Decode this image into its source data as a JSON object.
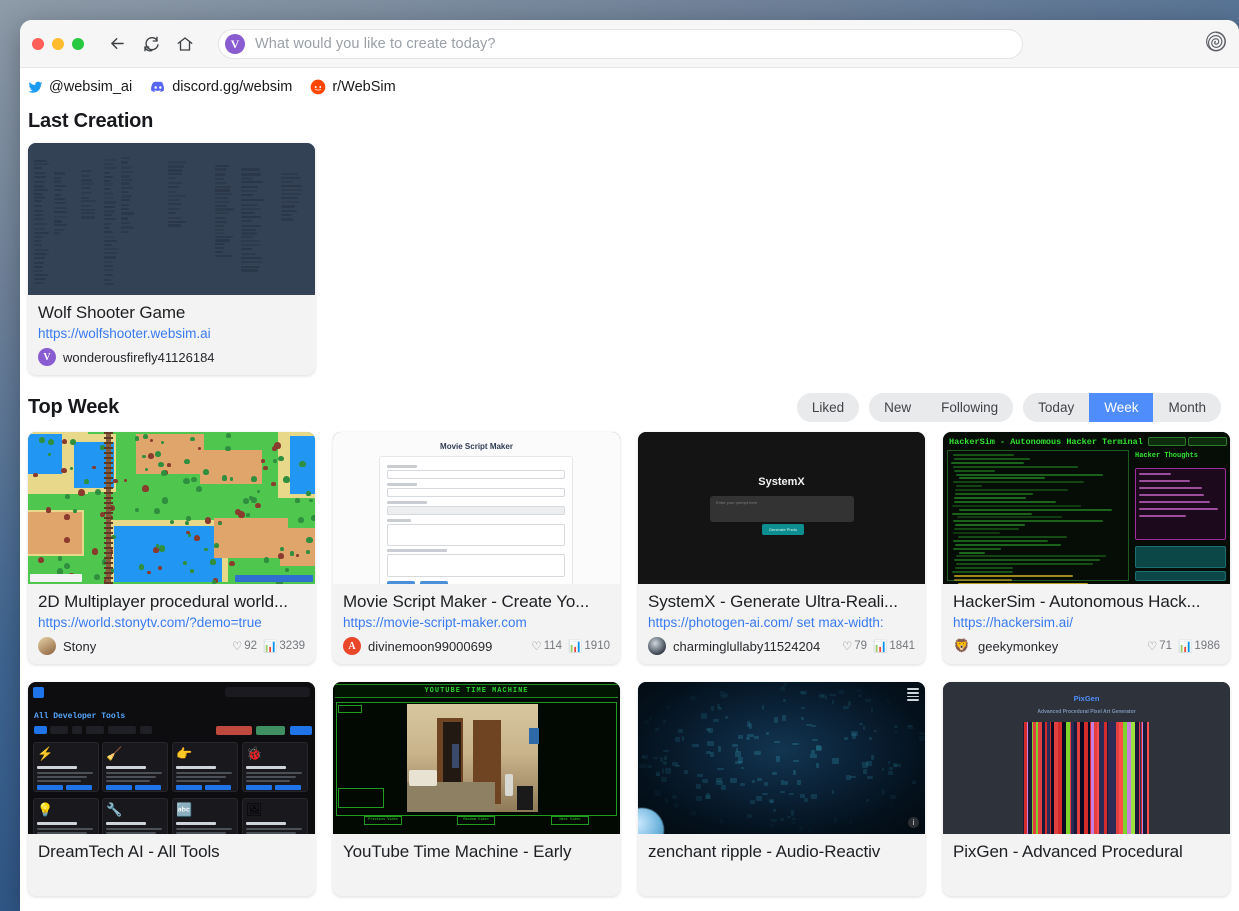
{
  "browser": {
    "back_label": "Back",
    "reload_label": "Reload",
    "home_label": "Home",
    "url_placeholder": "What would you like to create today?",
    "favicon_letter": "V",
    "spiral_label": "websim-logo"
  },
  "social": [
    {
      "icon": "twitter-icon",
      "label": "@websim_ai"
    },
    {
      "icon": "discord-icon",
      "label": "discord.gg/websim"
    },
    {
      "icon": "reddit-icon",
      "label": "r/WebSim"
    }
  ],
  "last_creation": {
    "heading": "Last Creation",
    "card": {
      "title": "Wolf Shooter Game",
      "url": "https://wolfshooter.websim.ai",
      "author": "wonderousfirefly41126184",
      "avatar_letter": "V",
      "avatar_color": "#8a5cd1"
    }
  },
  "top_week": {
    "heading": "Top Week",
    "filters_left": [
      "Liked"
    ],
    "filters_mid": [
      "New",
      "Following"
    ],
    "filters_right": [
      "Today",
      "Week",
      "Month"
    ],
    "active_filter": "Week",
    "accent_color": "#4f8dfd"
  },
  "cards": [
    {
      "title": "2D Multiplayer procedural world...",
      "url": "https://world.stonytv.com/?demo=true",
      "author": "Stony",
      "likes": "92",
      "views": "3239",
      "art": "world"
    },
    {
      "title": "Movie Script Maker - Create Yo...",
      "url": "https://movie-script-maker.com",
      "author": "divinemoon99000699",
      "avatar_letter": "A",
      "avatar_color": "#e8472a",
      "likes": "114",
      "views": "1910",
      "art": "msm",
      "art_title": "Movie Script Maker",
      "art_fields": [
        "Movie Name:",
        "Movie Genre:",
        "Number of Chapters:",
        "Synopsis:",
        "List of Characters (one per line):"
      ]
    },
    {
      "title": "SystemX - Generate Ultra-Reali...",
      "url": "https://photogen-ai.com/ set max-width:",
      "author": "charminglullaby11524204",
      "likes": "79",
      "views": "1841",
      "art": "sysx",
      "art_title": "SystemX",
      "art_placeholder": "Enter your prompt here",
      "art_button": "Generate Photo"
    },
    {
      "title": "HackerSim - Autonomous Hack...",
      "url": "https://hackersim.ai/",
      "author": "geekymonkey",
      "likes": "71",
      "views": "1986",
      "art": "hack",
      "art_title": "HackerSim - Autonomous Hacker Terminal",
      "art_panel": "Hacker Thoughts",
      "art_buttons": [
        "Auto Scroll",
        "Show Debug Log",
        "Submit Feedback Command"
      ]
    },
    {
      "title": "DreamTech AI - All Tools",
      "url": "",
      "author": "",
      "art": "dt",
      "art_title": "All Developer Tools",
      "art_search": "Search tools...",
      "art_tabs": [
        "All",
        "Code",
        "AI",
        "Design",
        "Productivity",
        "SEO"
      ],
      "art_tools": [
        "Code Runner",
        "Code Formatter",
        "Class/ID Generator",
        "Code Debugger",
        "Prompt Helper",
        "Tool Generator",
        "Font Generator",
        "Image Generator"
      ]
    },
    {
      "title": "YouTube Time Machine - Early",
      "url": "",
      "author": "",
      "art": "ytm",
      "art_title": "YOUTUBE TIME MACHINE",
      "art_buttons": [
        "Previous Video",
        "Random Video",
        "Next Video"
      ]
    },
    {
      "title": "zenchant ripple - Audio-Reactiv",
      "url": "",
      "author": "",
      "art": "zen"
    },
    {
      "title": "PixGen - Advanced Procedural",
      "url": "",
      "author": "",
      "art": "pix",
      "art_title": "PixGen",
      "art_subtitle": "Advanced Procedural Pixel Art Generator"
    }
  ]
}
